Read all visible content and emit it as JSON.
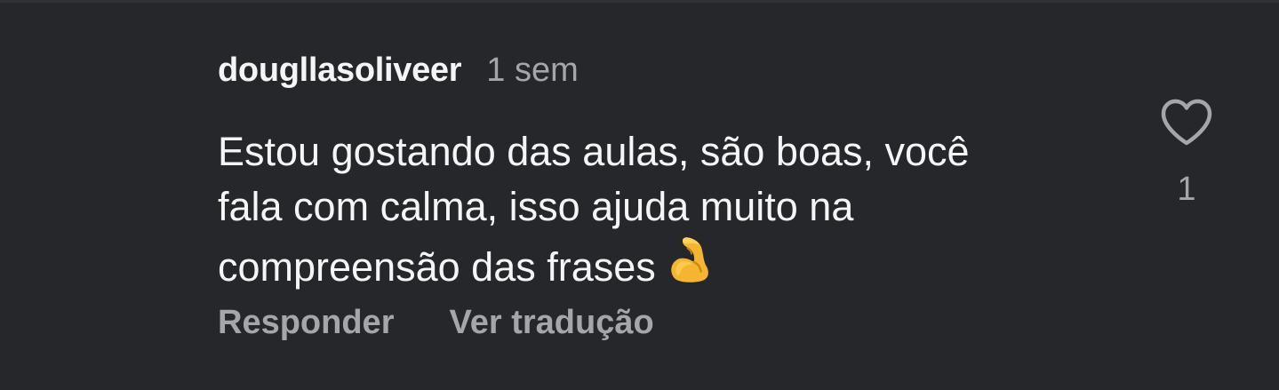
{
  "comment": {
    "username": "dougllasoliveer",
    "time_ago": "1 sem",
    "text_lines": [
      "Estou gostando das aulas, são boas, você",
      "fala com calma, isso ajuda muito na",
      "compreensão das frases"
    ],
    "emoji": "flexed-biceps-emoji",
    "like_icon": "heart-outline-icon",
    "like_count": "1"
  },
  "actions": {
    "reply_label": "Responder",
    "translate_label": "Ver tradução"
  },
  "colors": {
    "background": "#25272b",
    "primary_text": "#f4f5f6",
    "secondary_text": "#a3a6ab"
  }
}
